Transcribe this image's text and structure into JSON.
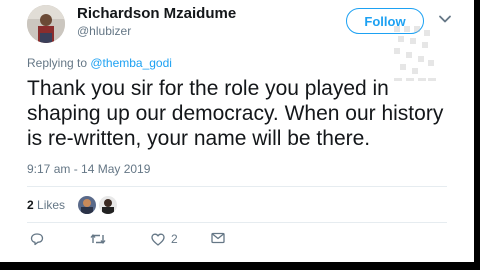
{
  "user": {
    "display_name": "Richardson Mzaidume",
    "handle": "@hlubizer"
  },
  "follow_label": "Follow",
  "reply": {
    "prefix": "Replying to ",
    "mention": "@themba_godi"
  },
  "tweet": {
    "text": "Thank you sir for the role you played in shaping up our democracy. When our history is re-written, your name will be there.",
    "timestamp": "9:17 am - 14 May 2019"
  },
  "likes": {
    "count": "2",
    "label": "Likes"
  },
  "actions": {
    "like_count": "2"
  },
  "icons": [
    "chevron-down-icon",
    "reply-icon",
    "retweet-icon",
    "like-icon",
    "message-icon"
  ],
  "colors": {
    "accent": "#1da1f2",
    "text": "#14171a",
    "muted": "#657786"
  }
}
